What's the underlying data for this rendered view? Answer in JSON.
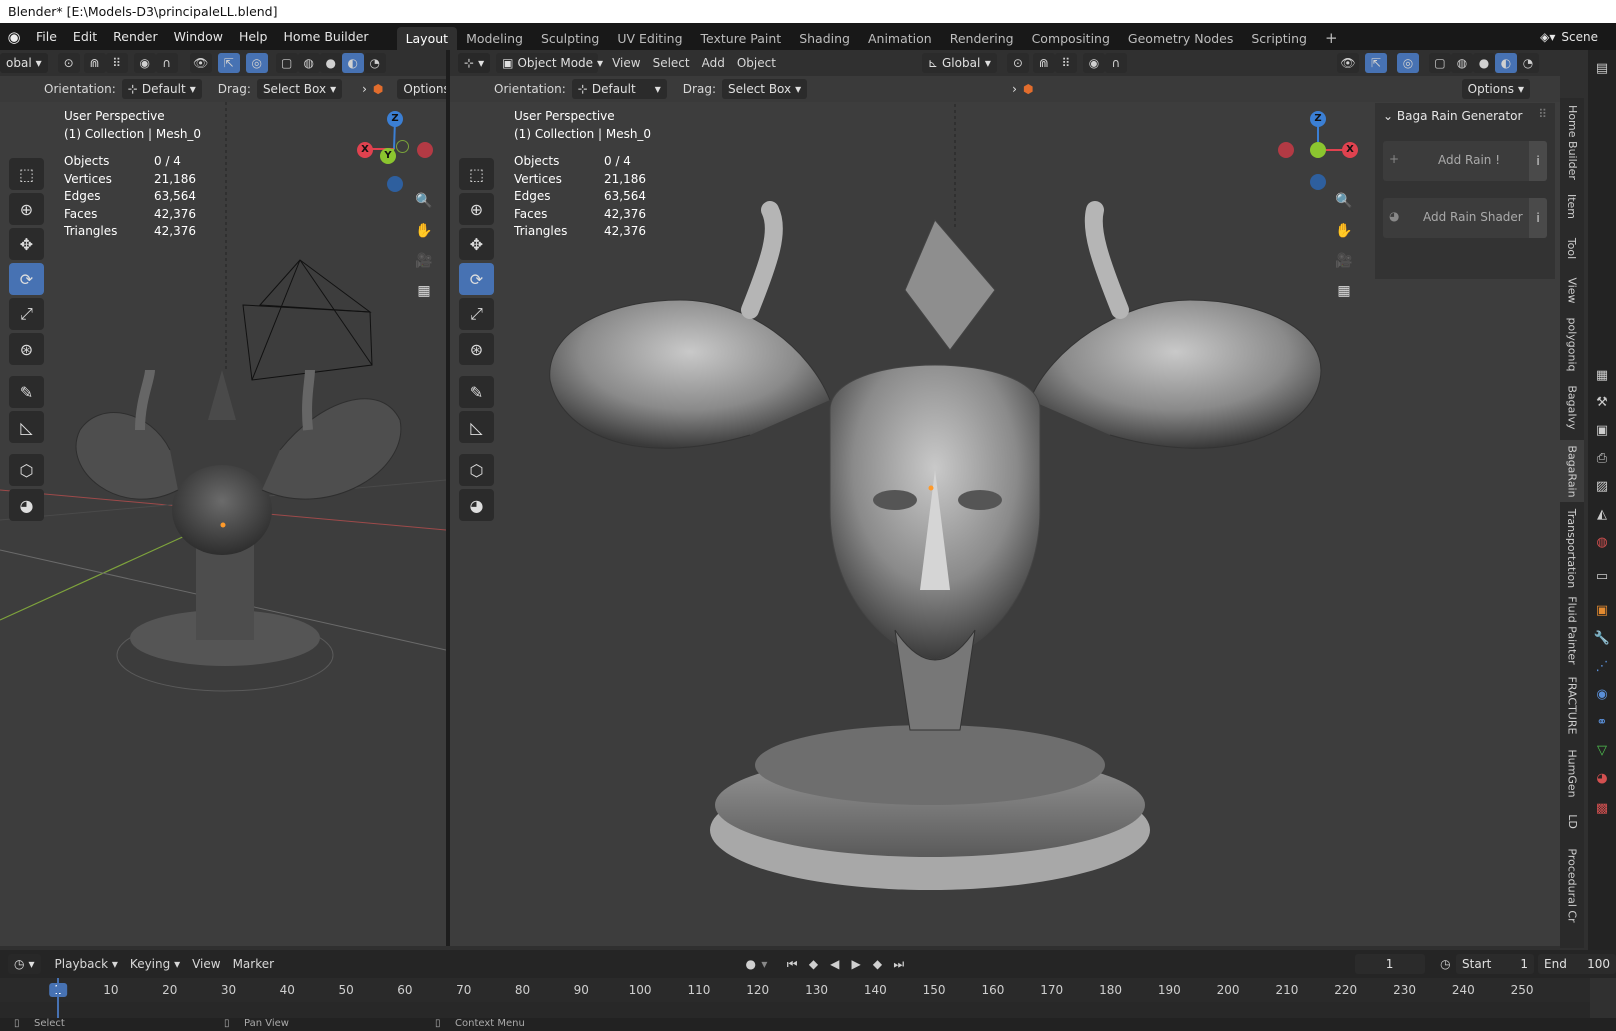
{
  "window_title": "Blender* [E:\\Models-D3\\principaleLL.blend]",
  "menu": [
    "File",
    "Edit",
    "Render",
    "Window",
    "Help",
    "Home Builder"
  ],
  "workspaces": [
    "Layout",
    "Modeling",
    "Sculpting",
    "UV Editing",
    "Texture Paint",
    "Shading",
    "Animation",
    "Rendering",
    "Compositing",
    "Geometry Nodes",
    "Scripting"
  ],
  "active_workspace": "Layout",
  "add_workspace": "+",
  "scene": {
    "name": "Scene"
  },
  "left_view": {
    "transform_orientation_cut": "obal",
    "orientation_label": "Orientation:",
    "orientation_value": "Default",
    "drag_label": "Drag:",
    "drag_value": "Select Box",
    "options_label": "Options",
    "perspective": "User Perspective",
    "collection": "(1) Collection | Mesh_0",
    "stats": {
      "objects_label": "Objects",
      "objects": "0 / 4",
      "vertices_label": "Vertices",
      "vertices": "21,186",
      "edges_label": "Edges",
      "edges": "63,564",
      "faces_label": "Faces",
      "faces": "42,376",
      "triangles_label": "Triangles",
      "triangles": "42,376"
    }
  },
  "right_view": {
    "mode": "Object Mode",
    "view_menu": "View",
    "select_menu": "Select",
    "add_menu": "Add",
    "object_menu": "Object",
    "transform_orientation": "Global",
    "options_label": "Options",
    "orientation_label": "Orientation:",
    "orientation_value": "Default",
    "drag_label": "Drag:",
    "drag_value": "Select Box",
    "perspective": "User Perspective",
    "collection": "(1) Collection | Mesh_0",
    "stats": {
      "objects_label": "Objects",
      "objects": "0 / 4",
      "vertices_label": "Vertices",
      "vertices": "21,186",
      "edges_label": "Edges",
      "edges": "63,564",
      "faces_label": "Faces",
      "faces": "42,376",
      "triangles_label": "Triangles",
      "triangles": "42,376"
    }
  },
  "gizmo_axes": {
    "z": "Z",
    "y": "Y",
    "x": "X"
  },
  "npanel": {
    "title": "Baga Rain Generator",
    "add_rain": "Add Rain !",
    "add_rain_shader": "Add Rain Shader",
    "info_glyph": "i"
  },
  "side_tabs": [
    "Home Builder",
    "Item",
    "Tool",
    "View",
    "polygoniq",
    "BagaIvy",
    "BagaRain",
    "Transportation",
    "Fluid Painter",
    "FRACTURE",
    "HumGen",
    "LD",
    "Procedural Cr"
  ],
  "timeline": {
    "playback": "Playback",
    "keying": "Keying",
    "view": "View",
    "marker": "Marker",
    "current_frame": "1",
    "start_label": "Start",
    "start": "1",
    "end_label": "End",
    "end": "100",
    "ticks": [
      "1",
      "10",
      "20",
      "30",
      "40",
      "50",
      "60",
      "70",
      "80",
      "90",
      "100",
      "110",
      "120",
      "130",
      "140",
      "150",
      "160",
      "170",
      "180",
      "190",
      "200",
      "210",
      "220",
      "230",
      "240",
      "250"
    ]
  },
  "status": {
    "select": "Select",
    "pan": "Pan View",
    "context": "Context Menu"
  },
  "colors": {
    "accent": "#4772b3",
    "x_axis": "#e0424f",
    "y_axis": "#8bc52f",
    "z_axis": "#3b7fd4",
    "origin": "#ff9a2a"
  }
}
